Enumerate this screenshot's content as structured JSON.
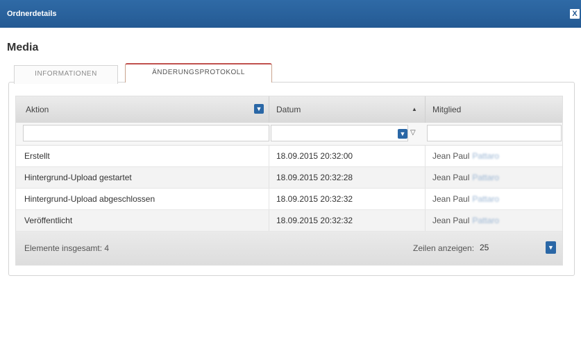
{
  "window": {
    "title": "Ordnerdetails",
    "close_glyph": "X"
  },
  "heading": "Media",
  "tabs": [
    {
      "label": "INFORMATIONEN",
      "active": false
    },
    {
      "label": "ÄNDERUNGSPROTOKOLL",
      "active": true
    }
  ],
  "grid": {
    "columns": [
      {
        "label": "Aktion"
      },
      {
        "label": "Datum",
        "sort": "▲"
      },
      {
        "label": "Mitglied"
      }
    ],
    "rows": [
      {
        "action": "Erstellt",
        "date": "18.09.2015 20:32:00",
        "member_first": "Jean Paul",
        "member_last": "Pattaro"
      },
      {
        "action": "Hintergrund-Upload gestartet",
        "date": "18.09.2015 20:32:28",
        "member_first": "Jean Paul",
        "member_last": "Pattaro"
      },
      {
        "action": "Hintergrund-Upload abgeschlossen",
        "date": "18.09.2015 20:32:32",
        "member_first": "Jean Paul",
        "member_last": "Pattaro"
      },
      {
        "action": "Veröffentlicht",
        "date": "18.09.2015 20:32:32",
        "member_first": "Jean Paul",
        "member_last": "Pattaro"
      }
    ],
    "footer": {
      "total_label": "Elemente insgesamt: 4",
      "rows_label": "Zeilen anzeigen:",
      "rows_value": "25"
    }
  },
  "colors": {
    "titlebar": "#2a62a0",
    "accent": "#2a67a6",
    "active_tab_border": "#c0504d"
  },
  "icons": {
    "dropdown": "chevron-down-icon",
    "filter": "funnel-icon",
    "close": "close-icon"
  }
}
